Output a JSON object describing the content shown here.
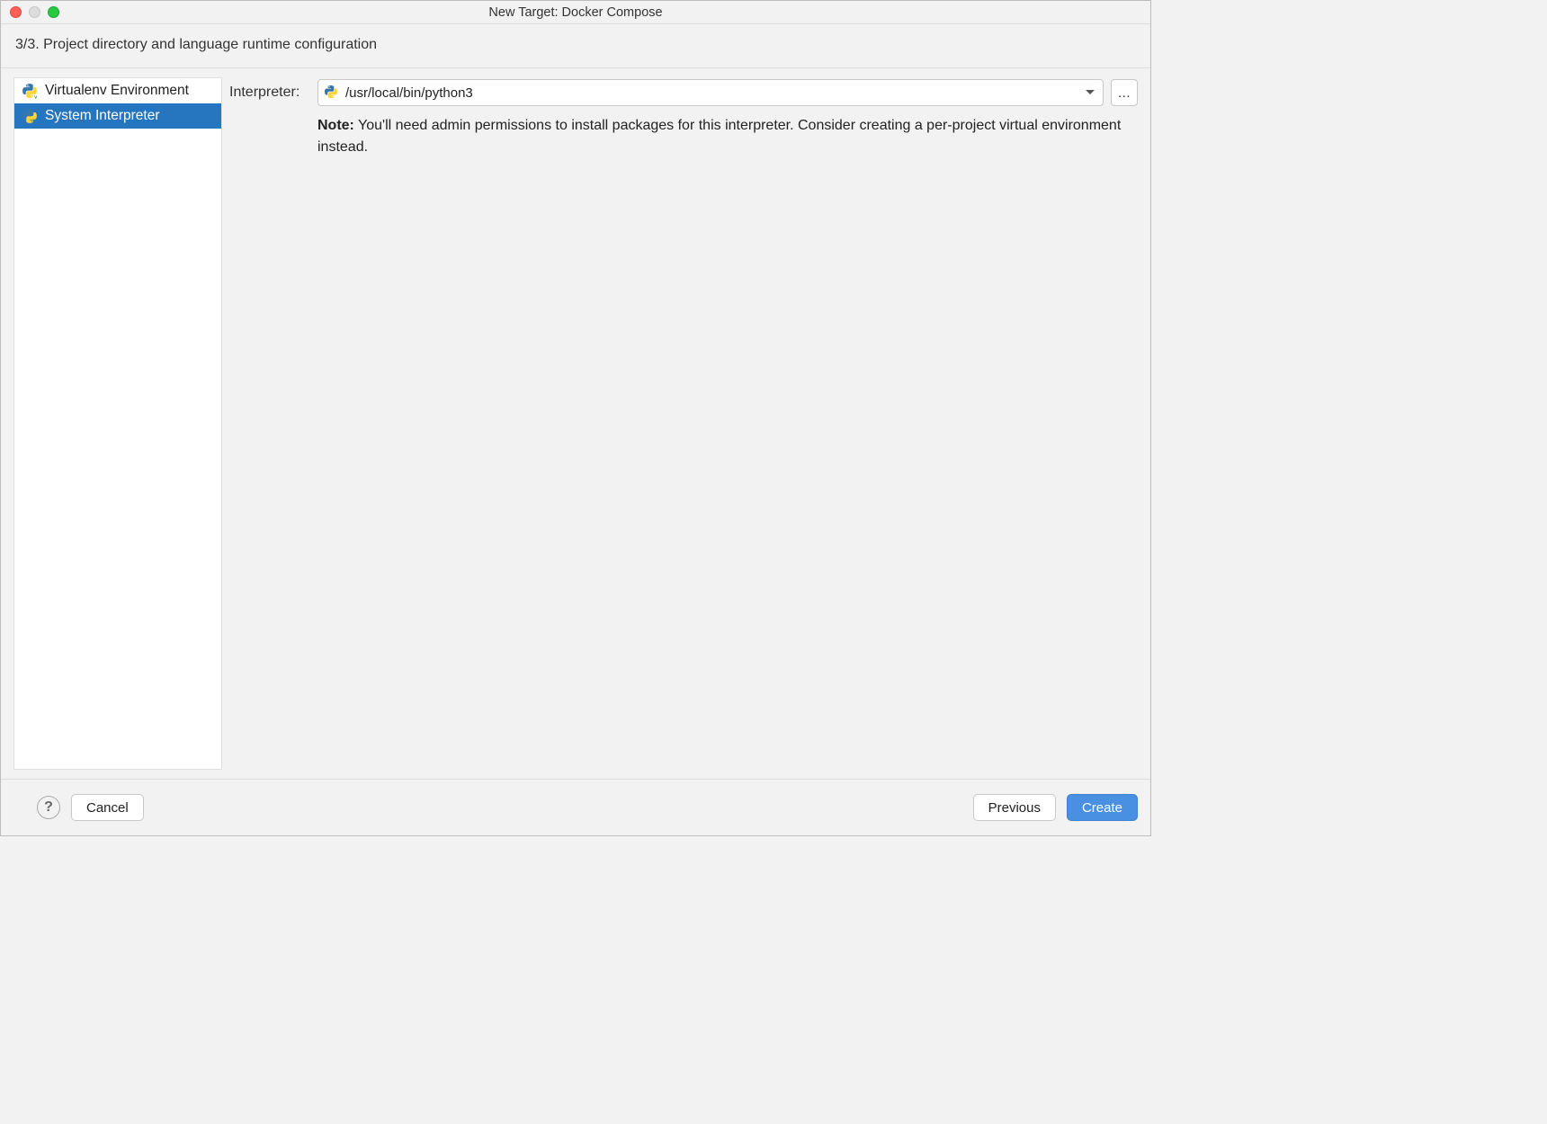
{
  "window": {
    "title": "New Target: Docker Compose",
    "subheader": "3/3. Project directory and language runtime configuration"
  },
  "sidebar": {
    "items": [
      {
        "label": "Virtualenv Environment",
        "selected": false
      },
      {
        "label": "System Interpreter",
        "selected": true
      }
    ]
  },
  "form": {
    "interpreter_label": "Interpreter:",
    "interpreter_value": "/usr/local/bin/python3",
    "browse_label": "...",
    "note_bold": "Note:",
    "note_text": " You'll need admin permissions to install packages for this interpreter. Consider creating a per-project virtual environment instead."
  },
  "footer": {
    "help": "?",
    "cancel": "Cancel",
    "previous": "Previous",
    "create": "Create"
  }
}
